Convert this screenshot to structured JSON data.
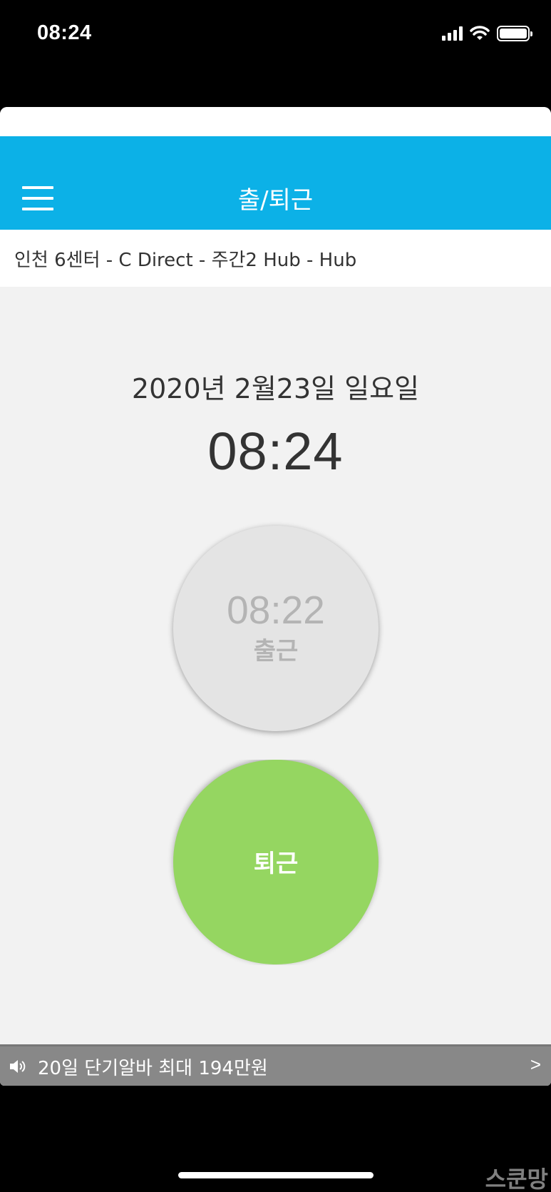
{
  "status_bar": {
    "time": "08:24",
    "icons": [
      "signal-icon",
      "wifi-icon",
      "battery-icon"
    ]
  },
  "header": {
    "title": "출/퇴근",
    "menu_icon": "hamburger-menu-icon",
    "color": "#0cb1e7"
  },
  "location": {
    "text": "인천 6센터 - C Direct - 주간2 Hub - Hub"
  },
  "main": {
    "date": "2020년 2월23일 일요일",
    "current_time": "08:24"
  },
  "clock_in": {
    "time": "08:22",
    "label": "출근"
  },
  "clock_out": {
    "label": "퇴근",
    "color": "#95d661"
  },
  "ad_banner": {
    "icon": "speaker-icon",
    "text": "20일 단기알바 최대 194만원",
    "arrow": ">"
  },
  "watermark": {
    "text": "스쿤망"
  }
}
